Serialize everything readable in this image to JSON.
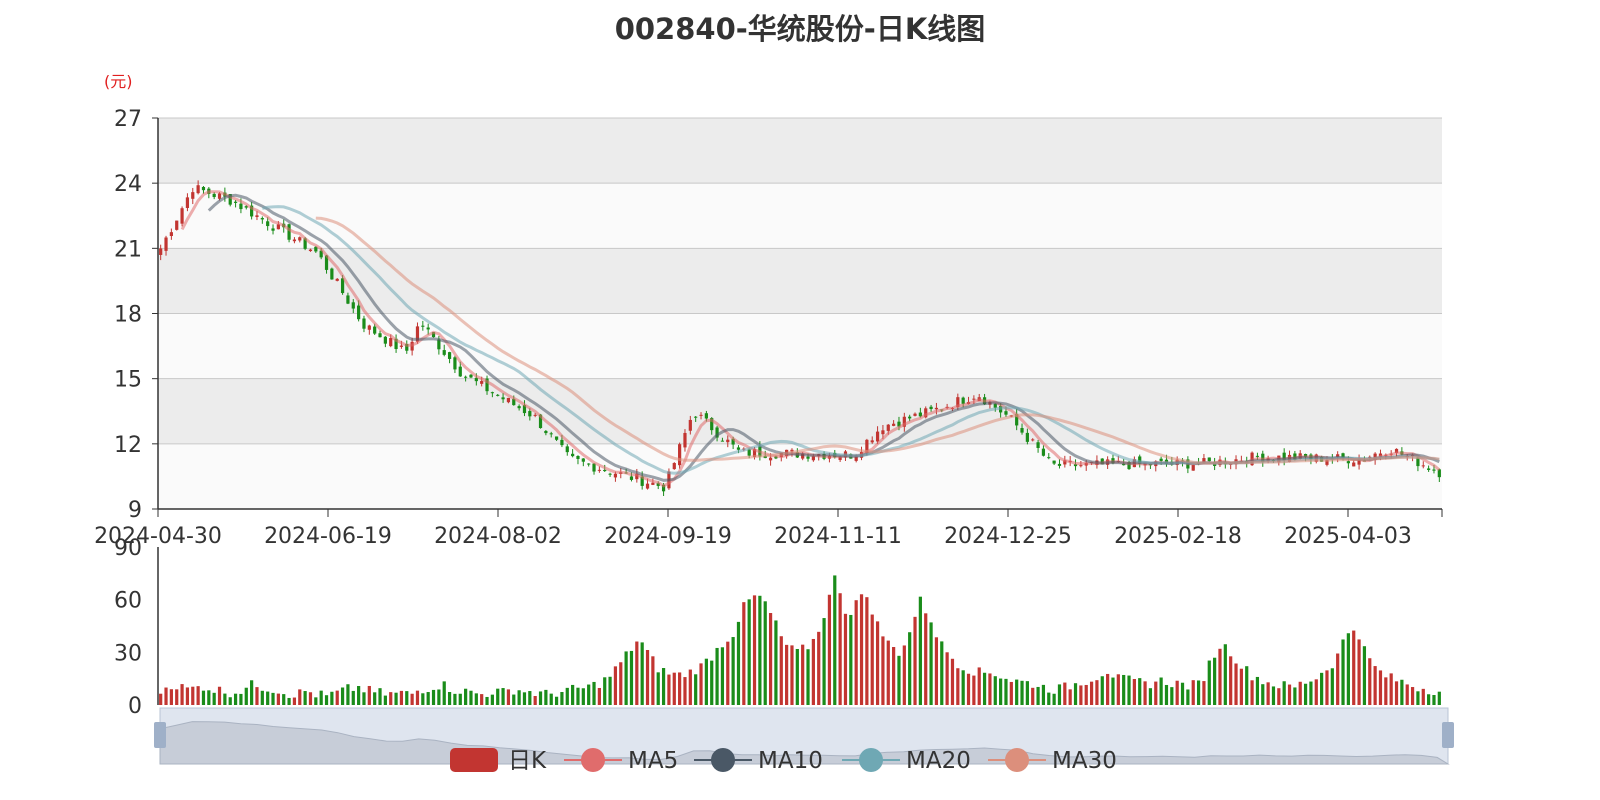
{
  "title": "002840-华统股份-日K线图",
  "unit_label": "(元)",
  "colors": {
    "up": "#c23531",
    "down": "#1a8c1a",
    "ma5": "#e06c6c",
    "ma10": "#4a5866",
    "ma20": "#6fa8b4",
    "ma30": "#dc8f7c",
    "band_dark": "#ececec",
    "band_light": "#fafafa",
    "slider_fill": "#dfe5ef"
  },
  "chart_data": [
    {
      "type": "candlestick",
      "title": "002840-华统股份-日K线图",
      "ylabel": "(元)",
      "ylim": [
        9,
        27
      ],
      "yticks": [
        "9",
        "12",
        "15",
        "18",
        "21",
        "24",
        "27"
      ],
      "xtick_labels": [
        "2024-04-30",
        "2024-06-19",
        "2024-08-02",
        "2024-09-19",
        "2024-11-11",
        "2024-12-25",
        "2025-02-18",
        "2025-04-03"
      ],
      "grid": true,
      "price_path_keypoints": [
        {
          "date": "2024-04-30",
          "close": 21.0
        },
        {
          "date": "2024-05-09",
          "close": 23.8
        },
        {
          "date": "2024-05-20",
          "close": 23.2
        },
        {
          "date": "2024-06-13",
          "close": 20.8
        },
        {
          "date": "2024-06-26",
          "close": 17.5
        },
        {
          "date": "2024-07-08",
          "close": 16.2
        },
        {
          "date": "2024-07-12",
          "close": 17.6
        },
        {
          "date": "2024-07-24",
          "close": 15.2
        },
        {
          "date": "2024-08-02",
          "close": 14.3
        },
        {
          "date": "2024-08-13",
          "close": 13.3
        },
        {
          "date": "2024-08-23",
          "close": 11.3
        },
        {
          "date": "2024-09-19",
          "close": 10.0
        },
        {
          "date": "2024-09-27",
          "close": 13.5
        },
        {
          "date": "2024-10-10",
          "close": 11.6
        },
        {
          "date": "2024-11-11",
          "close": 11.5
        },
        {
          "date": "2024-11-19",
          "close": 12.8
        },
        {
          "date": "2024-12-03",
          "close": 13.5
        },
        {
          "date": "2024-12-16",
          "close": 14.3
        },
        {
          "date": "2024-12-25",
          "close": 13.2
        },
        {
          "date": "2025-01-06",
          "close": 11.0
        },
        {
          "date": "2025-02-18",
          "close": 11.1
        },
        {
          "date": "2025-03-05",
          "close": 11.4
        },
        {
          "date": "2025-04-03",
          "close": 11.3
        },
        {
          "date": "2025-04-11",
          "close": 11.8
        },
        {
          "date": "2025-04-25",
          "close": 10.7
        }
      ],
      "series": [
        {
          "name": "日K"
        },
        {
          "name": "MA5"
        },
        {
          "name": "MA10"
        },
        {
          "name": "MA20"
        },
        {
          "name": "MA30"
        }
      ]
    },
    {
      "type": "bar",
      "ylim": [
        0,
        90
      ],
      "yticks": [
        "0",
        "30",
        "60",
        "90"
      ],
      "volume_profile": [
        8,
        12,
        10,
        9,
        11,
        9,
        8,
        7,
        9,
        12,
        10,
        9,
        7,
        6,
        8,
        6,
        5,
        7,
        9,
        10,
        8,
        7,
        6,
        7,
        6,
        9,
        10,
        12,
        9,
        8,
        7,
        6,
        8,
        7,
        9,
        8,
        7,
        6,
        7,
        8,
        9,
        10,
        12,
        15,
        22,
        30,
        38,
        28,
        20,
        18,
        17,
        19,
        22,
        28,
        35,
        40,
        55,
        62,
        60,
        48,
        35,
        30,
        32,
        38,
        55,
        75,
        50,
        60,
        62,
        45,
        35,
        30,
        40,
        60,
        50,
        35,
        28,
        22,
        20,
        18,
        19,
        16,
        14,
        13,
        12,
        10,
        9,
        10,
        12,
        14,
        16,
        20,
        15,
        14,
        13,
        12,
        14,
        13,
        12,
        11,
        12,
        25,
        35,
        30,
        22,
        17,
        14,
        12,
        11,
        10,
        13,
        15,
        20,
        25,
        40,
        45,
        28,
        20,
        16,
        14,
        12,
        10,
        9,
        8
      ]
    }
  ],
  "legend": [
    {
      "label": "日K",
      "icon": "candle-swatch-icon"
    },
    {
      "label": "MA5",
      "icon": "line-circle-icon"
    },
    {
      "label": "MA10",
      "icon": "line-circle-icon"
    },
    {
      "label": "MA20",
      "icon": "line-circle-icon"
    },
    {
      "label": "MA30",
      "icon": "line-circle-icon"
    }
  ]
}
